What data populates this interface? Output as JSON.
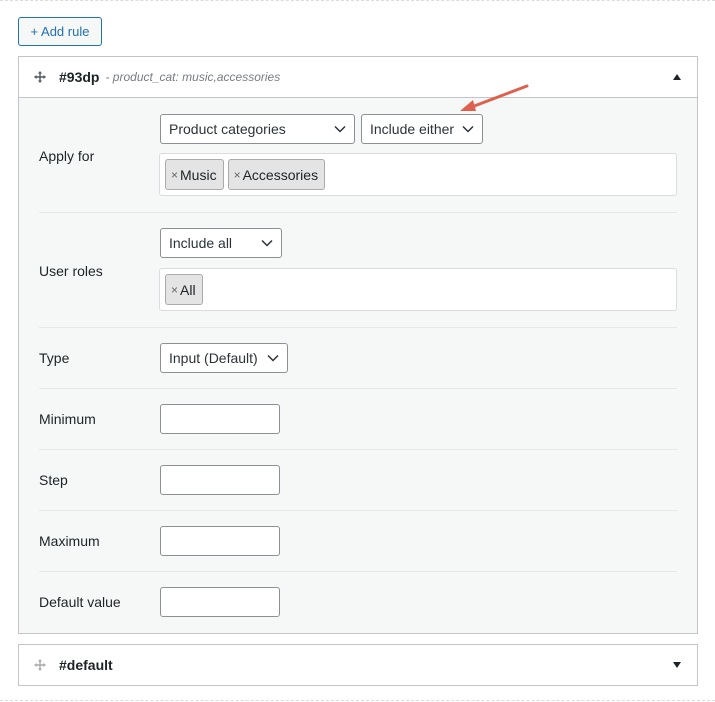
{
  "toolbar": {
    "add_rule_label": "+ Add rule"
  },
  "rule": {
    "id": "#93dp",
    "subtitle": "- product_cat: music,accessories",
    "apply_for": {
      "label": "Apply for",
      "source_select": "Product categories",
      "mode_select": "Include either",
      "tags": [
        "Music",
        "Accessories"
      ]
    },
    "user_roles": {
      "label": "User roles",
      "mode_select": "Include all",
      "tags": [
        "All"
      ]
    },
    "type": {
      "label": "Type",
      "select": "Input (Default)"
    },
    "minimum": {
      "label": "Minimum",
      "value": ""
    },
    "step": {
      "label": "Step",
      "value": ""
    },
    "maximum": {
      "label": "Maximum",
      "value": ""
    },
    "default_value": {
      "label": "Default value",
      "value": ""
    }
  },
  "default_rule": {
    "id": "#default"
  },
  "icons": {
    "move": "move-icon",
    "collapse": "triangle-up-icon",
    "expand": "triangle-down-icon",
    "chevron": "chevron-down-icon",
    "remove": "close-icon",
    "annotation": "red-arrow"
  },
  "colors": {
    "accent": "#2271b1",
    "panel_bg": "#f6f7f7",
    "border": "#c3c4c7",
    "tag_bg": "#e4e4e4",
    "arrow": "#e0604f"
  }
}
